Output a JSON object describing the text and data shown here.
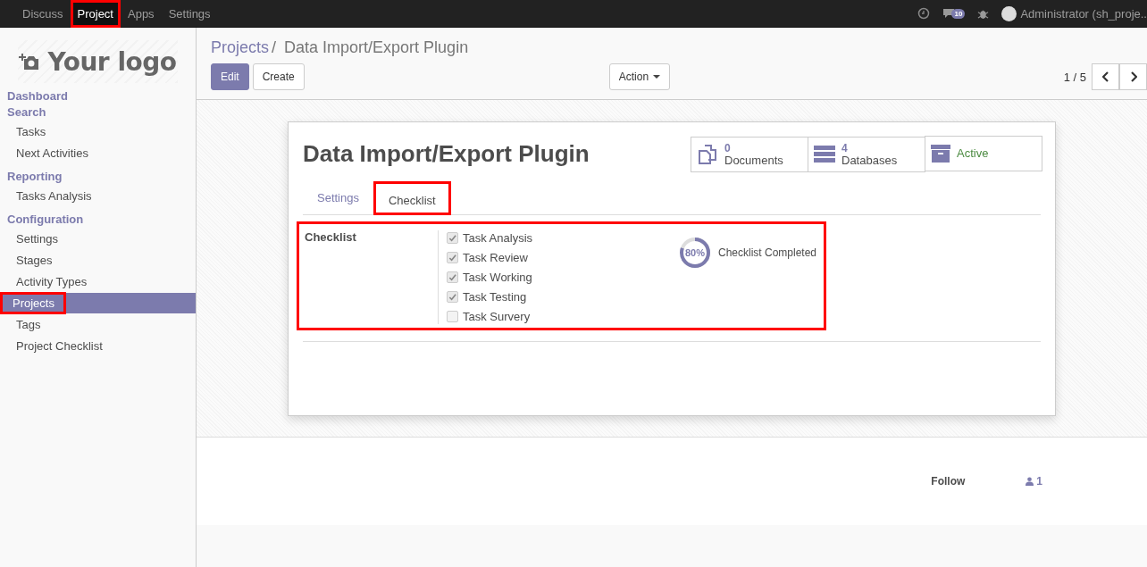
{
  "top_menu": [
    {
      "label": "Discuss",
      "selected": false,
      "highlighted": false
    },
    {
      "label": "Project",
      "selected": true,
      "highlighted": true
    },
    {
      "label": "Apps",
      "selected": false,
      "highlighted": false
    },
    {
      "label": "Settings",
      "selected": false,
      "highlighted": false
    }
  ],
  "systray": {
    "messages_count": "10",
    "user": "Administrator (sh_proje.."
  },
  "logo": {
    "text": "Your logo"
  },
  "sidebar": [
    {
      "heading": "Dashboard"
    },
    {
      "heading": "Search",
      "items": [
        {
          "label": "Tasks",
          "selected": false,
          "highlighted": false
        },
        {
          "label": "Next Activities",
          "selected": false,
          "highlighted": false
        }
      ]
    },
    {
      "heading": "Reporting",
      "items": [
        {
          "label": "Tasks Analysis",
          "selected": false,
          "highlighted": false
        }
      ]
    },
    {
      "heading": "Configuration",
      "items": [
        {
          "label": "Settings",
          "selected": false,
          "highlighted": false
        },
        {
          "label": "Stages",
          "selected": false,
          "highlighted": false
        },
        {
          "label": "Activity Types",
          "selected": false,
          "highlighted": false
        },
        {
          "label": "Projects",
          "selected": true,
          "highlighted": true
        },
        {
          "label": "Tags",
          "selected": false,
          "highlighted": false
        },
        {
          "label": "Project Checklist",
          "selected": false,
          "highlighted": false
        }
      ]
    }
  ],
  "breadcrumb": {
    "parent": "Projects",
    "separator": "/",
    "current": "Data Import/Export Plugin"
  },
  "buttons": {
    "edit": "Edit",
    "create": "Create",
    "action": "Action"
  },
  "pager": "1 / 5",
  "form": {
    "title": "Data Import/Export Plugin",
    "stat_buttons": [
      {
        "kind": "count",
        "value": "0",
        "label": "Documents"
      },
      {
        "kind": "count",
        "value": "4",
        "label": "Databases"
      },
      {
        "kind": "toggle",
        "label": "Active"
      }
    ],
    "tabs": [
      {
        "label": "Settings",
        "selected": false,
        "highlighted": false
      },
      {
        "label": "Checklist",
        "selected": true,
        "highlighted": true
      }
    ],
    "checklist": {
      "label": "Checklist",
      "highlighted": true,
      "items": [
        {
          "label": "Task Analysis",
          "checked": true
        },
        {
          "label": "Task Review",
          "checked": true
        },
        {
          "label": "Task Working",
          "checked": true
        },
        {
          "label": "Task Testing",
          "checked": true
        },
        {
          "label": "Task Survery",
          "checked": false
        }
      ],
      "progress": {
        "level": 0.8,
        "reading": "80%",
        "label": "Checklist Completed"
      }
    }
  },
  "chatter": {
    "follow": "Follow",
    "followers": "1"
  }
}
